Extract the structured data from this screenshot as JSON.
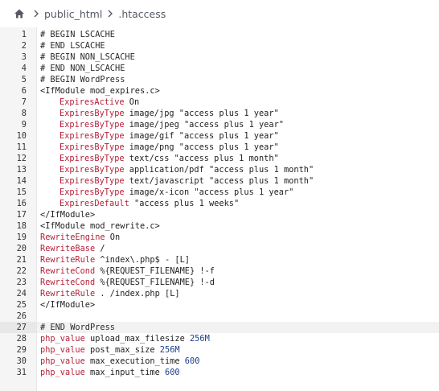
{
  "breadcrumb": {
    "home_icon": "home-icon",
    "separator_icon": "chevron-right-icon",
    "items": [
      "public_html",
      ".htaccess"
    ]
  },
  "editor": {
    "active_line": 27,
    "lines": [
      [
        {
          "t": "comment",
          "v": "# BEGIN LSCACHE"
        }
      ],
      [
        {
          "t": "comment",
          "v": "# END LSCACHE"
        }
      ],
      [
        {
          "t": "comment",
          "v": "# BEGIN NON_LSCACHE"
        }
      ],
      [
        {
          "t": "comment",
          "v": "# END NON_LSCACHE"
        }
      ],
      [
        {
          "t": "comment",
          "v": "# BEGIN WordPress"
        }
      ],
      [
        {
          "t": "tag",
          "v": "<IfModule mod_expires.c>"
        }
      ],
      [
        {
          "t": "indent",
          "v": ""
        },
        {
          "t": "key",
          "v": "ExpiresActive"
        },
        {
          "t": "text",
          "v": " On"
        }
      ],
      [
        {
          "t": "indent",
          "v": ""
        },
        {
          "t": "key",
          "v": "ExpiresByType"
        },
        {
          "t": "text",
          "v": " image/jpg \"access plus 1 year\""
        }
      ],
      [
        {
          "t": "indent",
          "v": ""
        },
        {
          "t": "key",
          "v": "ExpiresByType"
        },
        {
          "t": "text",
          "v": " image/jpeg \"access plus 1 year\""
        }
      ],
      [
        {
          "t": "indent",
          "v": ""
        },
        {
          "t": "key",
          "v": "ExpiresByType"
        },
        {
          "t": "text",
          "v": " image/gif \"access plus 1 year\""
        }
      ],
      [
        {
          "t": "indent",
          "v": ""
        },
        {
          "t": "key",
          "v": "ExpiresByType"
        },
        {
          "t": "text",
          "v": " image/png \"access plus 1 year\""
        }
      ],
      [
        {
          "t": "indent",
          "v": ""
        },
        {
          "t": "key",
          "v": "ExpiresByType"
        },
        {
          "t": "text",
          "v": " text/css \"access plus 1 month\""
        }
      ],
      [
        {
          "t": "indent",
          "v": ""
        },
        {
          "t": "key",
          "v": "ExpiresByType"
        },
        {
          "t": "text",
          "v": " application/pdf \"access plus 1 month\""
        }
      ],
      [
        {
          "t": "indent",
          "v": ""
        },
        {
          "t": "key",
          "v": "ExpiresByType"
        },
        {
          "t": "text",
          "v": " text/javascript \"access plus 1 month\""
        }
      ],
      [
        {
          "t": "indent",
          "v": ""
        },
        {
          "t": "key",
          "v": "ExpiresByType"
        },
        {
          "t": "text",
          "v": " image/x-icon \"access plus 1 year\""
        }
      ],
      [
        {
          "t": "indent",
          "v": ""
        },
        {
          "t": "key",
          "v": "ExpiresDefault"
        },
        {
          "t": "text",
          "v": " \"access plus 1 weeks\""
        }
      ],
      [
        {
          "t": "tag",
          "v": "</IfModule>"
        }
      ],
      [
        {
          "t": "tag",
          "v": "<IfModule mod_rewrite.c>"
        }
      ],
      [
        {
          "t": "key",
          "v": "RewriteEngine"
        },
        {
          "t": "text",
          "v": " On"
        }
      ],
      [
        {
          "t": "key",
          "v": "RewriteBase"
        },
        {
          "t": "text",
          "v": " /"
        }
      ],
      [
        {
          "t": "key",
          "v": "RewriteRule"
        },
        {
          "t": "text",
          "v": " ^index\\.php$ - [L]"
        }
      ],
      [
        {
          "t": "key",
          "v": "RewriteCond"
        },
        {
          "t": "text",
          "v": " %{REQUEST_FILENAME} !-f"
        }
      ],
      [
        {
          "t": "key",
          "v": "RewriteCond"
        },
        {
          "t": "text",
          "v": " %{REQUEST_FILENAME} !-d"
        }
      ],
      [
        {
          "t": "key",
          "v": "RewriteRule"
        },
        {
          "t": "text",
          "v": " . /index.php [L]"
        }
      ],
      [
        {
          "t": "tag",
          "v": "</IfModule>"
        }
      ],
      [],
      [
        {
          "t": "comment",
          "v": "# END WordPress"
        }
      ],
      [
        {
          "t": "key",
          "v": "php_value"
        },
        {
          "t": "text",
          "v": " upload_max_filesize "
        },
        {
          "t": "num",
          "v": "256M"
        }
      ],
      [
        {
          "t": "key",
          "v": "php_value"
        },
        {
          "t": "text",
          "v": " post_max_size "
        },
        {
          "t": "num",
          "v": "256M"
        }
      ],
      [
        {
          "t": "key",
          "v": "php_value"
        },
        {
          "t": "text",
          "v": " max_execution_time "
        },
        {
          "t": "num",
          "v": "600"
        }
      ],
      [
        {
          "t": "key",
          "v": "php_value"
        },
        {
          "t": "text",
          "v": " max_input_time "
        },
        {
          "t": "num",
          "v": "600"
        }
      ]
    ]
  }
}
